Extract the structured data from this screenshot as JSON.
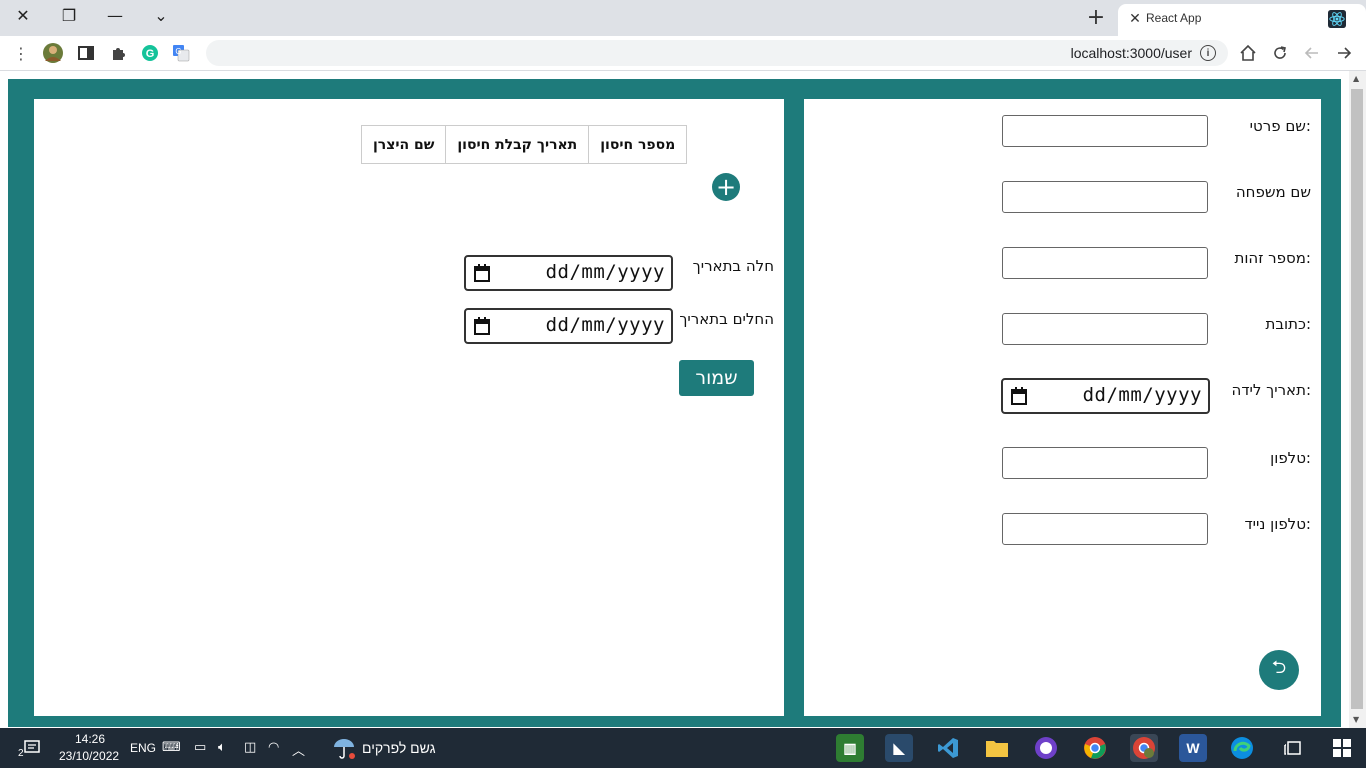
{
  "browser": {
    "tab_title": "React App",
    "url": "localhost:3000/user",
    "close_tab": "✕",
    "new_tab": "+",
    "window_close": "✕",
    "window_restore": "❐",
    "window_minimize": "—",
    "tab_search": "⌄",
    "info": "i",
    "menu": "⋮",
    "star": "☆"
  },
  "personal_form": {
    "fields": [
      {
        "label": ":שם פרטי"
      },
      {
        "label": "שם משפחה"
      },
      {
        "label": ":מספר זהות"
      },
      {
        "label": ":כתובת"
      },
      {
        "label": ":תאריך לידה",
        "placeholder": "dd/mm/yyyy"
      },
      {
        "label": ":טלפון"
      },
      {
        "label": ":טלפון נייד"
      }
    ],
    "back_button": "⮌"
  },
  "vaccination": {
    "headers": [
      "מספר חיסון",
      "תאריך קבלת חיסון",
      "שם היצרן"
    ],
    "add_button": "+",
    "sick_date_label": "חלה בתאריך",
    "recovered_date_label": "החלים בתאריך",
    "date_placeholder": "dd/mm/yyyy",
    "save_button": "שמור"
  },
  "taskbar": {
    "weather_text": "גשם לפרקים",
    "time": "14:26",
    "date": "23/10/2022",
    "lang": "ENG",
    "notification_count": "2"
  },
  "colors": {
    "accent": "#1e7b7b",
    "taskbar": "#1f2a36"
  }
}
